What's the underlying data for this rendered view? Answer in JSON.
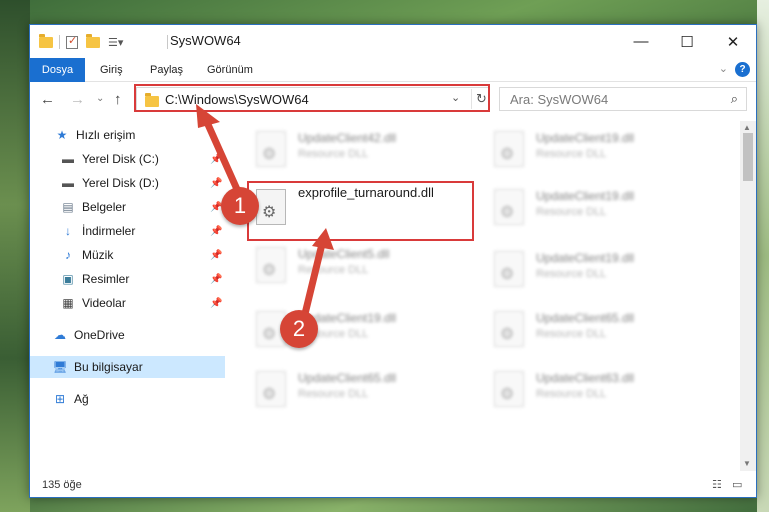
{
  "window": {
    "title": "SysWOW64"
  },
  "ribbon": {
    "tabs": [
      "Dosya",
      "Giriş",
      "Paylaş",
      "Görünüm"
    ]
  },
  "address": {
    "path": "C:\\Windows\\SysWOW64"
  },
  "search": {
    "placeholder": "Ara: SysWOW64"
  },
  "sidebar": {
    "items": [
      {
        "label": "Hızlı erişim",
        "icon": "star-icon"
      },
      {
        "label": "Yerel Disk (C:)",
        "icon": "drive-icon",
        "pinned": true
      },
      {
        "label": "Yerel Disk (D:)",
        "icon": "drive-icon",
        "pinned": true
      },
      {
        "label": "Belgeler",
        "icon": "documents-icon",
        "pinned": true
      },
      {
        "label": "İndirmeler",
        "icon": "download-icon",
        "pinned": true
      },
      {
        "label": "Müzik",
        "icon": "music-icon",
        "pinned": true
      },
      {
        "label": "Resimler",
        "icon": "pictures-icon",
        "pinned": true
      },
      {
        "label": "Videolar",
        "icon": "video-icon",
        "pinned": true
      },
      {
        "label": "OneDrive",
        "icon": "cloud-icon"
      },
      {
        "label": "Bu bilgisayar",
        "icon": "computer-icon",
        "selected": true
      },
      {
        "label": "Ağ",
        "icon": "network-icon"
      }
    ]
  },
  "files": {
    "focused": {
      "name": "exprofile_turnaround.dll"
    },
    "left": [
      {
        "name": "UpdateClient42.dll",
        "type": "Resource DLL"
      },
      {
        "name": "UpdateClient5.dll",
        "type": "Resource DLL"
      },
      {
        "name": "UpdateClient19.dll",
        "type": "Resource DLL"
      },
      {
        "name": "UpdateClient65.dll",
        "type": "Resource DLL"
      }
    ],
    "right": [
      {
        "name": "UpdateClient19.dll",
        "type": "Resource DLL"
      },
      {
        "name": "UpdateClient19.dll",
        "type": "Resource DLL"
      },
      {
        "name": "UpdateClient19.dll",
        "type": "Resource DLL"
      },
      {
        "name": "UpdateClient65.dll",
        "type": "Resource DLL"
      },
      {
        "name": "UpdateClient63.dll",
        "type": "Resource DLL"
      }
    ]
  },
  "status": {
    "item_count": "135 öğe"
  },
  "annotations": {
    "step1": "1",
    "step2": "2",
    "color": "#d64536"
  },
  "colors": {
    "accent": "#1a6fd0",
    "selected": "#cce8ff",
    "highlight_box": "#d93a3a"
  }
}
